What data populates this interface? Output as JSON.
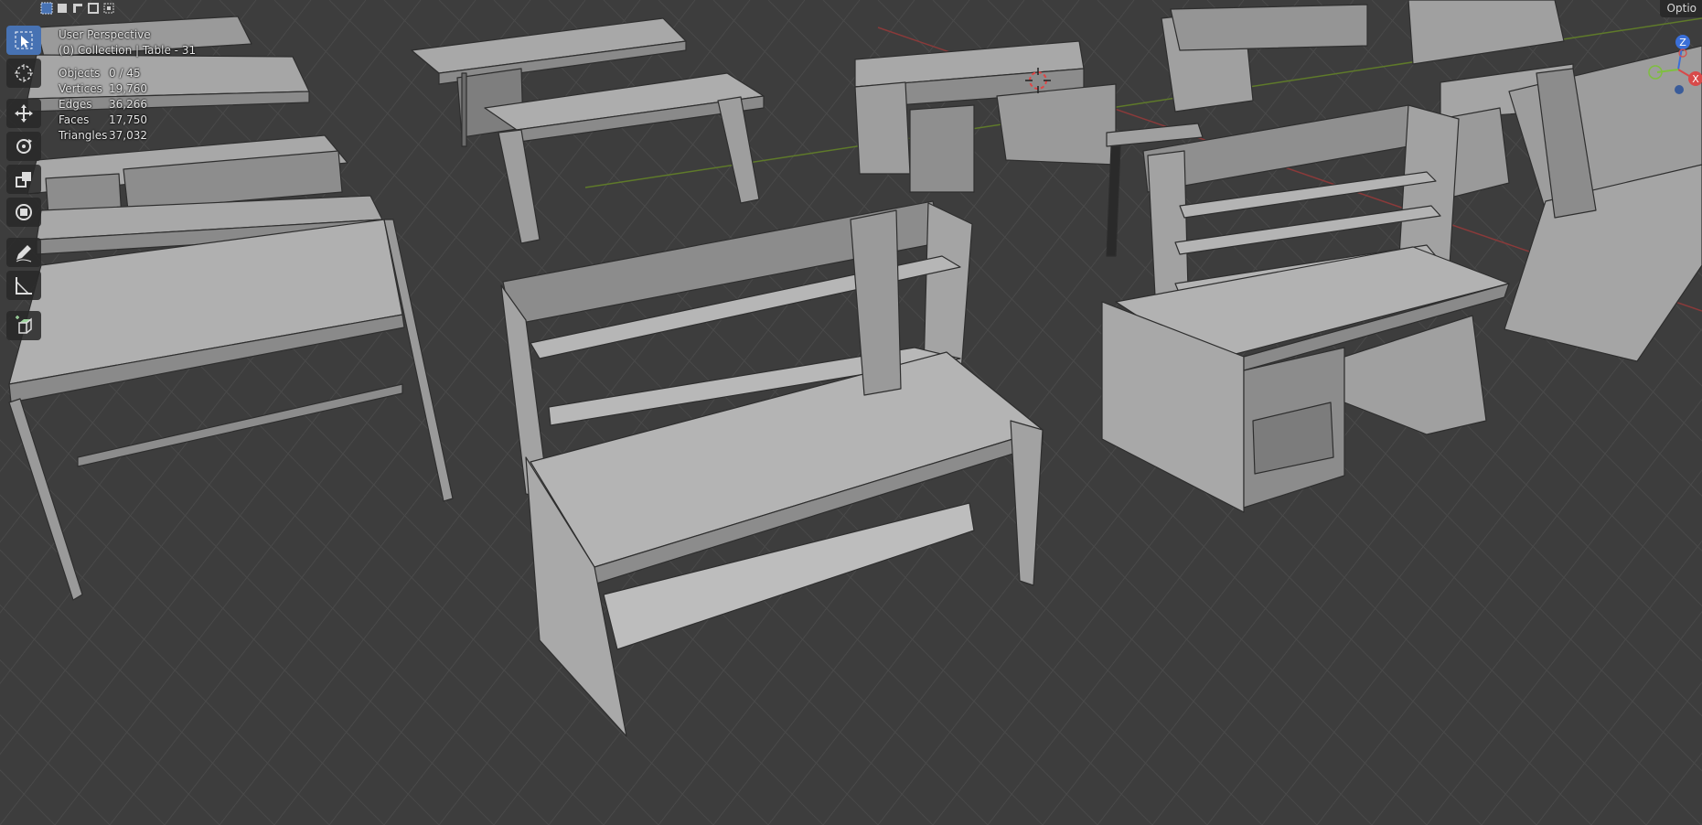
{
  "header": {
    "options_label": "Optio"
  },
  "viewport": {
    "view_name": "User Perspective",
    "collection_info": "(0) Collection | Table - 31",
    "stats": [
      {
        "key": "Objects",
        "value": "0 / 45"
      },
      {
        "key": "Vertices",
        "value": "19,760"
      },
      {
        "key": "Edges",
        "value": "36,266"
      },
      {
        "key": "Faces",
        "value": "17,750"
      },
      {
        "key": "Triangles",
        "value": "37,032"
      }
    ]
  },
  "toolbar": {
    "tools": [
      {
        "name": "select-box",
        "active": true
      },
      {
        "name": "cursor",
        "active": false
      },
      {
        "name": "move",
        "active": false
      },
      {
        "name": "rotate",
        "active": false
      },
      {
        "name": "scale",
        "active": false
      },
      {
        "name": "transform",
        "active": false
      },
      {
        "name": "annotate",
        "active": false
      },
      {
        "name": "measure",
        "active": false
      },
      {
        "name": "add-cube",
        "active": false
      }
    ]
  },
  "gizmo": {
    "z_label": "Z",
    "x_label": "X"
  },
  "colors": {
    "background": "#3d3d3d",
    "grid": "#4a4a4a",
    "x_axis": "#8a3a3a",
    "y_axis": "#5f7a2a",
    "mesh": "#a8a8a8",
    "active_tool": "#4772b3"
  }
}
